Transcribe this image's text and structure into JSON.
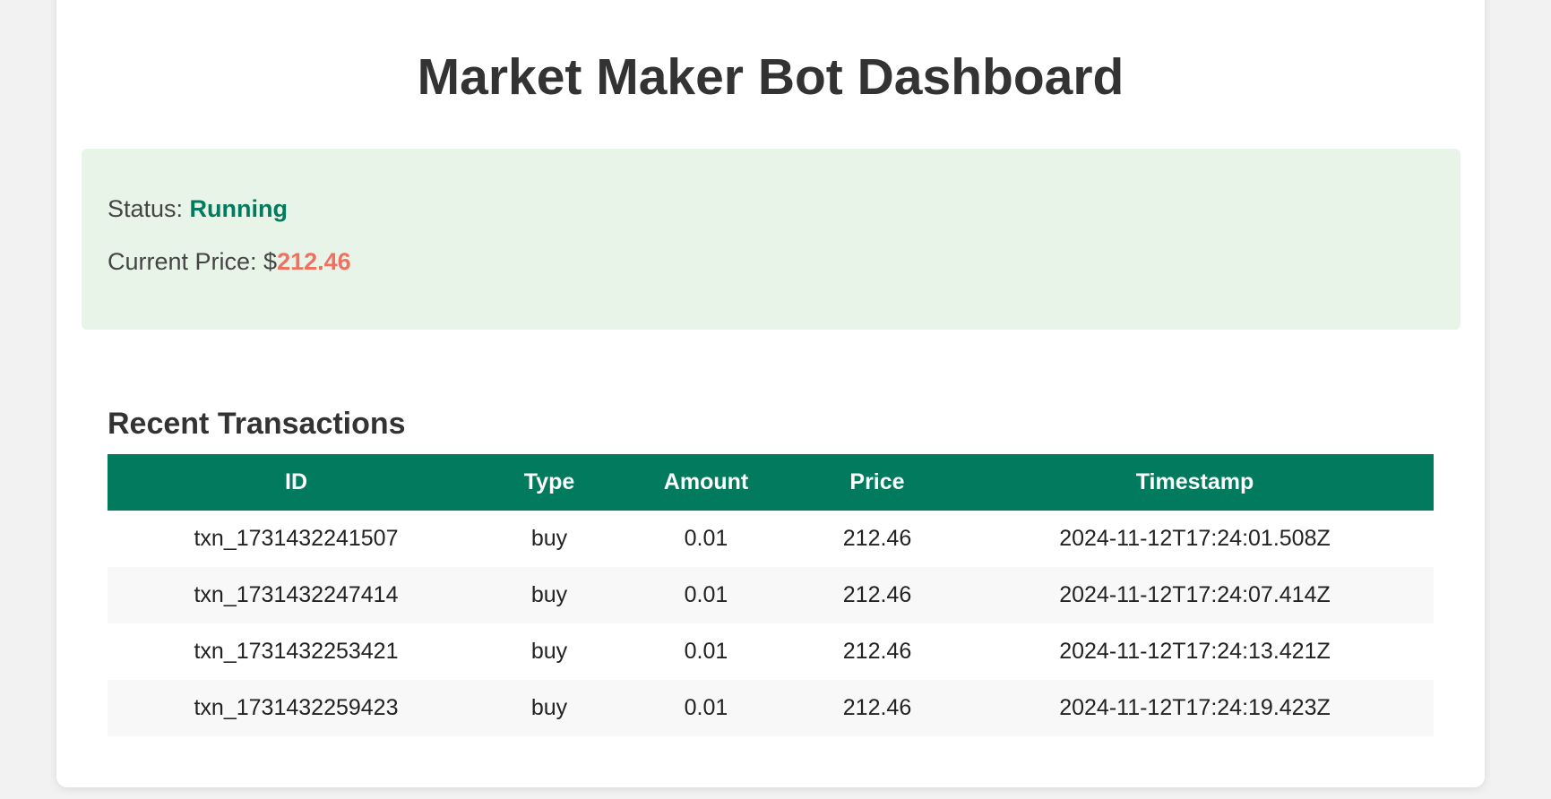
{
  "page": {
    "title": "Market Maker Bot Dashboard"
  },
  "status_panel": {
    "status_label": "Status: ",
    "status_value": "Running",
    "price_label": "Current Price: $",
    "price_value": "212.46"
  },
  "transactions": {
    "title": "Recent Transactions",
    "columns": [
      "ID",
      "Type",
      "Amount",
      "Price",
      "Timestamp"
    ],
    "rows": [
      [
        "txn_1731432241507",
        "buy",
        "0.01",
        "212.46",
        "2024-11-12T17:24:01.508Z"
      ],
      [
        "txn_1731432247414",
        "buy",
        "0.01",
        "212.46",
        "2024-11-12T17:24:07.414Z"
      ],
      [
        "txn_1731432253421",
        "buy",
        "0.01",
        "212.46",
        "2024-11-12T17:24:13.421Z"
      ],
      [
        "txn_1731432259423",
        "buy",
        "0.01",
        "212.46",
        "2024-11-12T17:24:19.423Z"
      ]
    ]
  },
  "colors": {
    "accent": "#017a5e",
    "price": "#f07162",
    "panel_background": "#e8f4e8"
  }
}
